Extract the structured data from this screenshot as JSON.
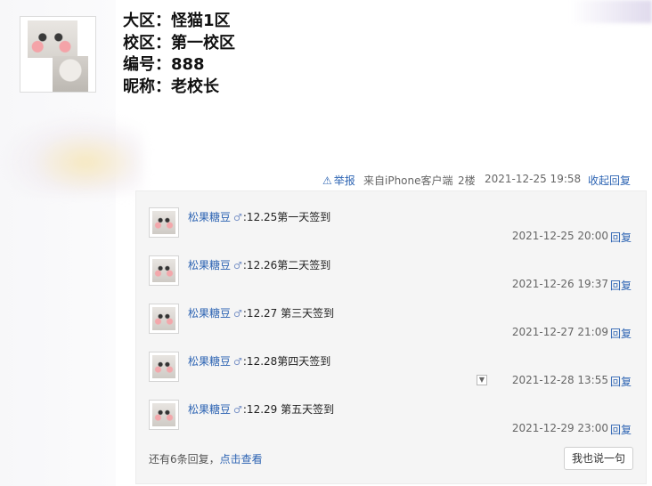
{
  "profile": {
    "rows": [
      {
        "label": "大区：",
        "value": "怪猫1区"
      },
      {
        "label": "校区：",
        "value": "第一校区"
      },
      {
        "label": "编号：",
        "value": "888"
      },
      {
        "label": "昵称：",
        "value": "老校长"
      }
    ]
  },
  "post_meta": {
    "report_icon": "warning-icon",
    "report_label": "举报",
    "source": "来自iPhone客户端",
    "floor": "2楼",
    "timestamp": "2021-12-25 19:58",
    "collapse_label": "收起回复"
  },
  "replies": [
    {
      "user": "松果糖豆",
      "gender": "♂",
      "content": ":12.25第一天签到",
      "time": "2021-12-25 20:00",
      "reply_label": "回复"
    },
    {
      "user": "松果糖豆",
      "gender": "♂",
      "content": ":12.26第二天签到",
      "time": "2021-12-26 19:37",
      "reply_label": "回复"
    },
    {
      "user": "松果糖豆",
      "gender": "♂",
      "content": ":12.27 第三天签到",
      "time": "2021-12-27 21:09",
      "reply_label": "回复"
    },
    {
      "user": "松果糖豆",
      "gender": "♂",
      "content": ":12.28第四天签到",
      "time": "2021-12-28 13:55",
      "reply_label": "回复"
    },
    {
      "user": "松果糖豆",
      "gender": "♂",
      "content": ":12.29 第五天签到",
      "time": "2021-12-29 23:00",
      "reply_label": "回复"
    }
  ],
  "footer": {
    "more_prefix": "还有6条回复，",
    "more_link": "点击查看",
    "say_button": "我也说一句"
  },
  "icons": {
    "dropdown": "chevron-down-icon"
  },
  "colors": {
    "link": "#2d64b3",
    "panel_bg": "#f5f5f5"
  }
}
